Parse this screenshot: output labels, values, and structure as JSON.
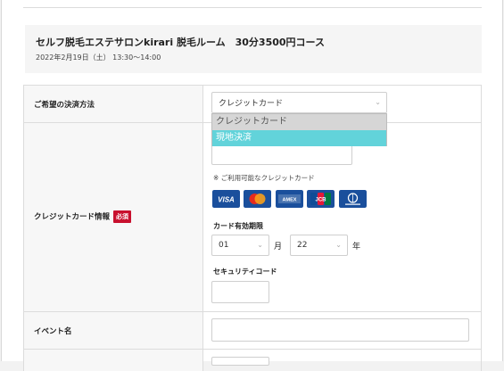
{
  "course": {
    "title": "セルフ脱毛エステサロンkirari 脱毛ルーム　30分3500円コース",
    "datetime": "2022年2月19日（土） 13:30～14:00"
  },
  "payment_method": {
    "label": "ご希望の決済方法",
    "selected": "クレジットカード",
    "options": [
      "クレジットカード",
      "現地決済"
    ]
  },
  "credit_card": {
    "label": "クレジットカード情報",
    "required_badge": "必須",
    "available_note": "※ ご利用可能なクレジットカード",
    "brands": [
      "VISA",
      "Mastercard",
      "American Express",
      "JCB",
      "Diners Club"
    ],
    "expiry_label": "カード有効期限",
    "expiry_month": "01",
    "month_unit": "月",
    "expiry_year": "22",
    "year_unit": "年",
    "security_code_label": "セキュリティコード"
  },
  "event": {
    "label": "イベント名"
  },
  "colors": {
    "required": "#c8102e",
    "highlight": "#62d3da",
    "card_blue": "#1a4f9c"
  }
}
